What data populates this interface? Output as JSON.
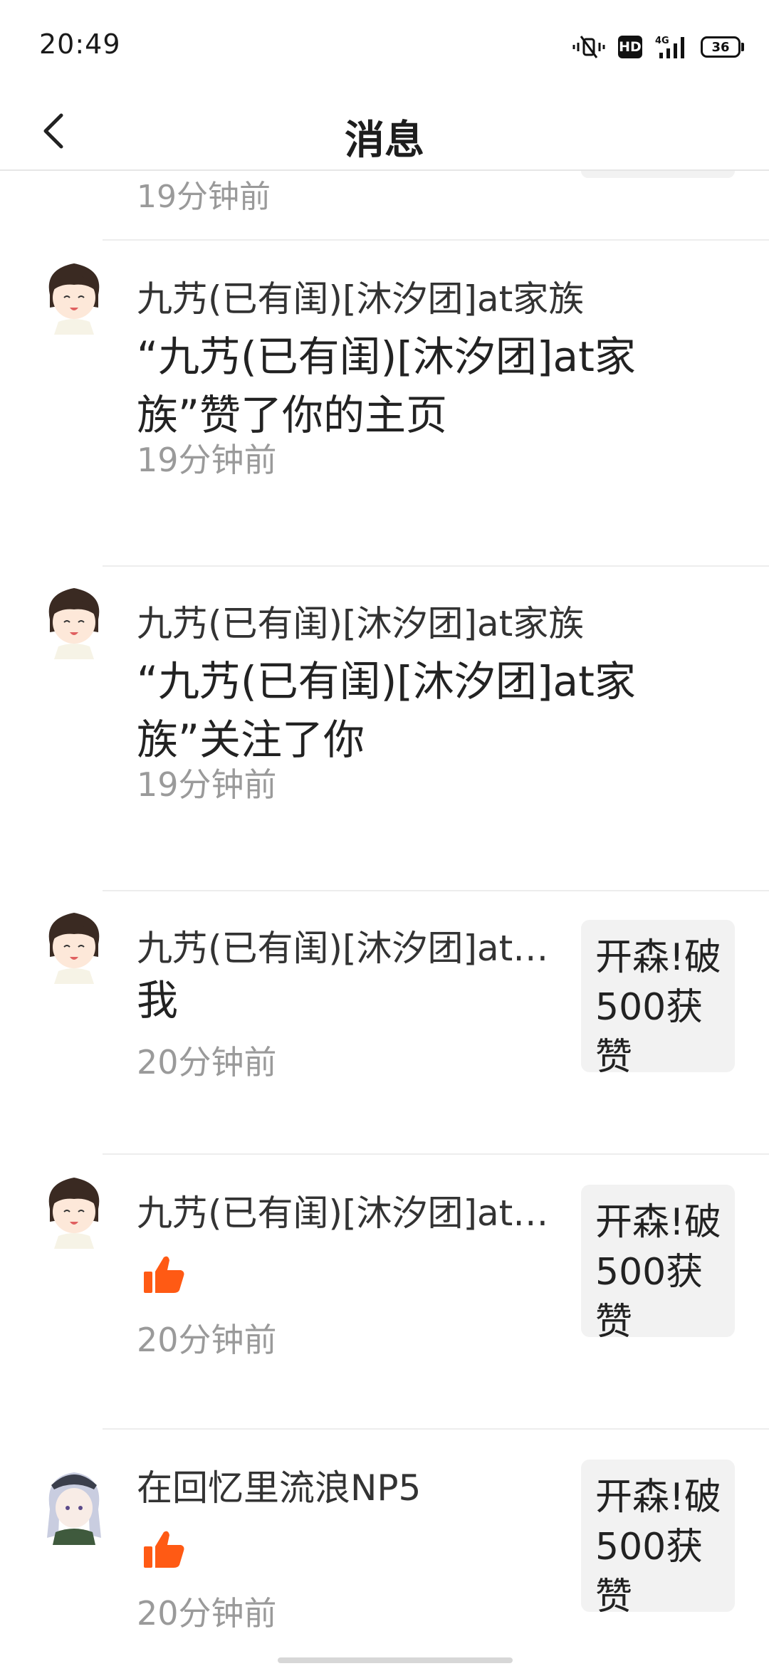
{
  "status_bar": {
    "time": "20:49",
    "hd_label": "HD",
    "network_label": "4G",
    "battery_level": "36",
    "icons": [
      "vibrate-mute-icon",
      "hd-icon",
      "signal-4g-icon",
      "battery-icon"
    ]
  },
  "header": {
    "title": "消息",
    "back_icon": "chevron-left-icon"
  },
  "partial_item": {
    "time": "19分钟前"
  },
  "items": [
    {
      "name": "九艿(已有闺)[沐汐团]at家族",
      "content": "“九艿(已有闺)[沐汐团]at家族”赞了你的主页",
      "time": "19分钟前",
      "avatar": "anime-girl-avatar"
    },
    {
      "name": "九艿(已有闺)[沐汐团]at家族",
      "content": "“九艿(已有闺)[沐汐团]at家族”关注了你",
      "time": "19分钟前",
      "avatar": "anime-girl-avatar"
    },
    {
      "name": "九艿(已有闺)[沐汐团]at家族",
      "content": "我",
      "time": "20分钟前",
      "avatar": "anime-girl-avatar",
      "thumb_text": "开森!破500获赞"
    },
    {
      "name": "九艿(已有闺)[沐汐团]at家族",
      "content_icon": "thumbs-up-icon",
      "time": "20分钟前",
      "avatar": "anime-girl-avatar",
      "thumb_text": "开森!破500获赞"
    },
    {
      "name": "在回忆里流浪NP5",
      "content_icon": "thumbs-up-icon",
      "time": "20分钟前",
      "avatar": "silver-hair-girl-avatar",
      "thumb_text": "开森!破500获赞"
    }
  ],
  "colors": {
    "like_orange": "#ff5a14",
    "divider": "#ededed",
    "time_gray": "#9a9a9a"
  }
}
